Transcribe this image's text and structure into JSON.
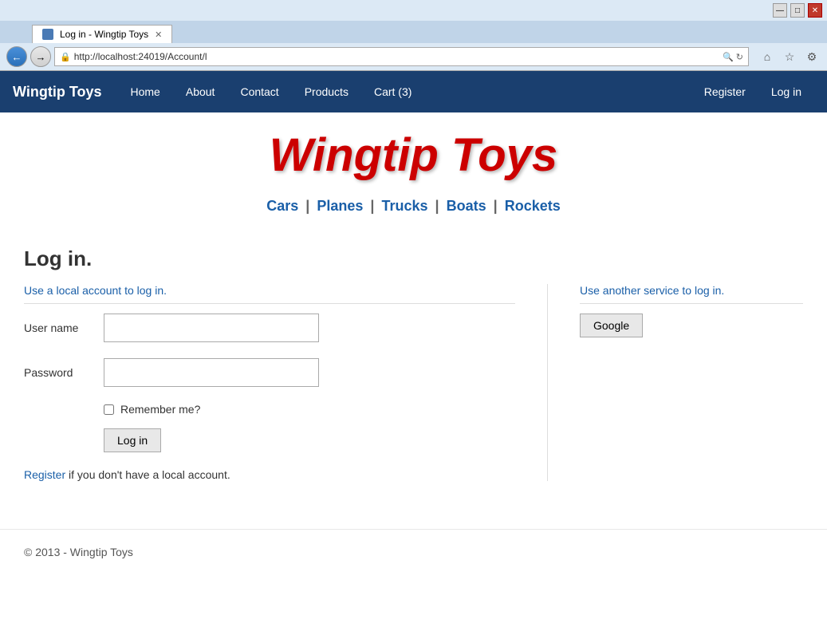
{
  "browser": {
    "title_bar_buttons": [
      "—",
      "□",
      "✕"
    ],
    "tab": {
      "icon": "page-icon",
      "label": "Log in - Wingtip Toys",
      "close": "✕"
    },
    "address": {
      "url": "http://localhost:24019/Account/l",
      "refresh": "↻",
      "stop": "✕"
    },
    "nav_buttons": {
      "back": "←",
      "forward": "→"
    },
    "toolbar_icons": {
      "home": "⌂",
      "star": "☆",
      "gear": "⚙"
    }
  },
  "navbar": {
    "brand": "Wingtip Toys",
    "links": [
      "Home",
      "About",
      "Contact",
      "Products",
      "Cart (3)"
    ],
    "right_links": [
      "Register",
      "Log in"
    ]
  },
  "site_header": {
    "title": "Wingtip Toys"
  },
  "categories": {
    "items": [
      "Cars",
      "Planes",
      "Trucks",
      "Boats",
      "Rockets"
    ],
    "separator": "|"
  },
  "login_page": {
    "heading": "Log in.",
    "local_section_title": "Use a local account to log in.",
    "other_section_title": "Use another service to log in.",
    "username_label": "User name",
    "password_label": "Password",
    "remember_me_label": "Remember me?",
    "login_button": "Log in",
    "register_text": "if you don't have a local account.",
    "register_link_label": "Register",
    "google_button": "Google"
  },
  "footer": {
    "text": "© 2013 - Wingtip Toys"
  }
}
